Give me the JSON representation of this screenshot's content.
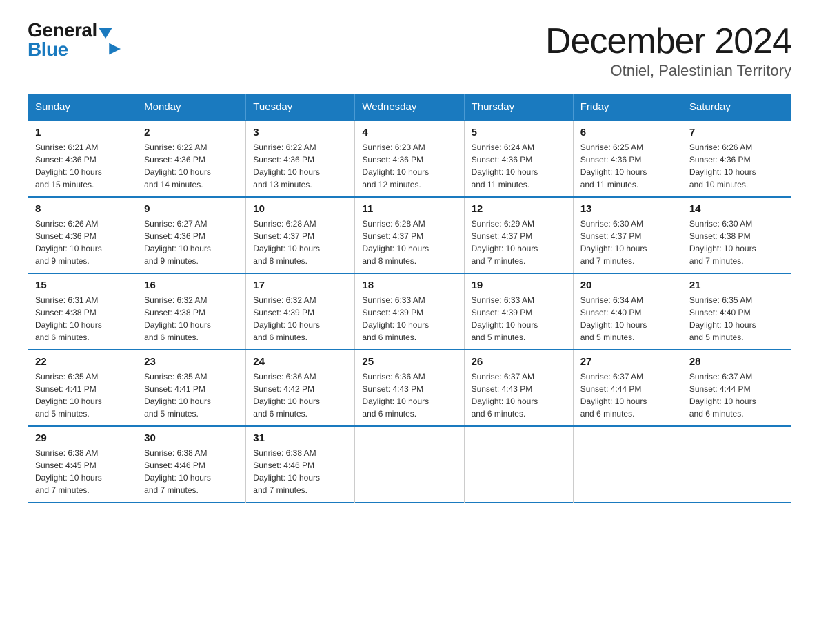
{
  "logo": {
    "general": "General",
    "blue": "Blue",
    "triangle": "▼"
  },
  "title": "December 2024",
  "subtitle": "Otniel, Palestinian Territory",
  "headers": [
    "Sunday",
    "Monday",
    "Tuesday",
    "Wednesday",
    "Thursday",
    "Friday",
    "Saturday"
  ],
  "weeks": [
    [
      {
        "day": "1",
        "sunrise": "6:21 AM",
        "sunset": "4:36 PM",
        "daylight": "10 hours and 15 minutes."
      },
      {
        "day": "2",
        "sunrise": "6:22 AM",
        "sunset": "4:36 PM",
        "daylight": "10 hours and 14 minutes."
      },
      {
        "day": "3",
        "sunrise": "6:22 AM",
        "sunset": "4:36 PM",
        "daylight": "10 hours and 13 minutes."
      },
      {
        "day": "4",
        "sunrise": "6:23 AM",
        "sunset": "4:36 PM",
        "daylight": "10 hours and 12 minutes."
      },
      {
        "day": "5",
        "sunrise": "6:24 AM",
        "sunset": "4:36 PM",
        "daylight": "10 hours and 11 minutes."
      },
      {
        "day": "6",
        "sunrise": "6:25 AM",
        "sunset": "4:36 PM",
        "daylight": "10 hours and 11 minutes."
      },
      {
        "day": "7",
        "sunrise": "6:26 AM",
        "sunset": "4:36 PM",
        "daylight": "10 hours and 10 minutes."
      }
    ],
    [
      {
        "day": "8",
        "sunrise": "6:26 AM",
        "sunset": "4:36 PM",
        "daylight": "10 hours and 9 minutes."
      },
      {
        "day": "9",
        "sunrise": "6:27 AM",
        "sunset": "4:36 PM",
        "daylight": "10 hours and 9 minutes."
      },
      {
        "day": "10",
        "sunrise": "6:28 AM",
        "sunset": "4:37 PM",
        "daylight": "10 hours and 8 minutes."
      },
      {
        "day": "11",
        "sunrise": "6:28 AM",
        "sunset": "4:37 PM",
        "daylight": "10 hours and 8 minutes."
      },
      {
        "day": "12",
        "sunrise": "6:29 AM",
        "sunset": "4:37 PM",
        "daylight": "10 hours and 7 minutes."
      },
      {
        "day": "13",
        "sunrise": "6:30 AM",
        "sunset": "4:37 PM",
        "daylight": "10 hours and 7 minutes."
      },
      {
        "day": "14",
        "sunrise": "6:30 AM",
        "sunset": "4:38 PM",
        "daylight": "10 hours and 7 minutes."
      }
    ],
    [
      {
        "day": "15",
        "sunrise": "6:31 AM",
        "sunset": "4:38 PM",
        "daylight": "10 hours and 6 minutes."
      },
      {
        "day": "16",
        "sunrise": "6:32 AM",
        "sunset": "4:38 PM",
        "daylight": "10 hours and 6 minutes."
      },
      {
        "day": "17",
        "sunrise": "6:32 AM",
        "sunset": "4:39 PM",
        "daylight": "10 hours and 6 minutes."
      },
      {
        "day": "18",
        "sunrise": "6:33 AM",
        "sunset": "4:39 PM",
        "daylight": "10 hours and 6 minutes."
      },
      {
        "day": "19",
        "sunrise": "6:33 AM",
        "sunset": "4:39 PM",
        "daylight": "10 hours and 5 minutes."
      },
      {
        "day": "20",
        "sunrise": "6:34 AM",
        "sunset": "4:40 PM",
        "daylight": "10 hours and 5 minutes."
      },
      {
        "day": "21",
        "sunrise": "6:35 AM",
        "sunset": "4:40 PM",
        "daylight": "10 hours and 5 minutes."
      }
    ],
    [
      {
        "day": "22",
        "sunrise": "6:35 AM",
        "sunset": "4:41 PM",
        "daylight": "10 hours and 5 minutes."
      },
      {
        "day": "23",
        "sunrise": "6:35 AM",
        "sunset": "4:41 PM",
        "daylight": "10 hours and 5 minutes."
      },
      {
        "day": "24",
        "sunrise": "6:36 AM",
        "sunset": "4:42 PM",
        "daylight": "10 hours and 6 minutes."
      },
      {
        "day": "25",
        "sunrise": "6:36 AM",
        "sunset": "4:43 PM",
        "daylight": "10 hours and 6 minutes."
      },
      {
        "day": "26",
        "sunrise": "6:37 AM",
        "sunset": "4:43 PM",
        "daylight": "10 hours and 6 minutes."
      },
      {
        "day": "27",
        "sunrise": "6:37 AM",
        "sunset": "4:44 PM",
        "daylight": "10 hours and 6 minutes."
      },
      {
        "day": "28",
        "sunrise": "6:37 AM",
        "sunset": "4:44 PM",
        "daylight": "10 hours and 6 minutes."
      }
    ],
    [
      {
        "day": "29",
        "sunrise": "6:38 AM",
        "sunset": "4:45 PM",
        "daylight": "10 hours and 7 minutes."
      },
      {
        "day": "30",
        "sunrise": "6:38 AM",
        "sunset": "4:46 PM",
        "daylight": "10 hours and 7 minutes."
      },
      {
        "day": "31",
        "sunrise": "6:38 AM",
        "sunset": "4:46 PM",
        "daylight": "10 hours and 7 minutes."
      },
      null,
      null,
      null,
      null
    ]
  ],
  "labels": {
    "sunrise": "Sunrise:",
    "sunset": "Sunset:",
    "daylight": "Daylight:"
  }
}
